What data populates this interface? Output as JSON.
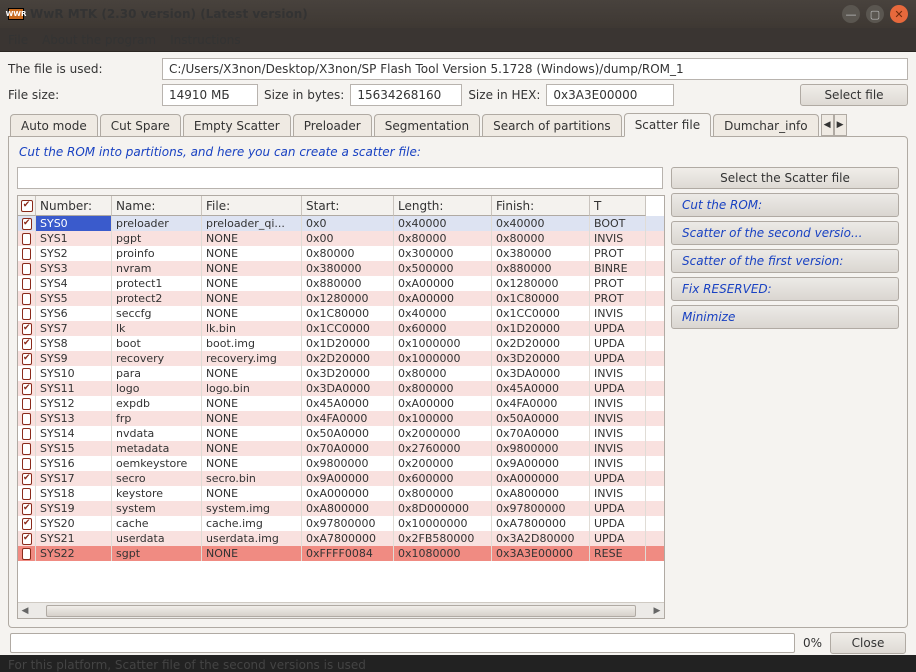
{
  "window": {
    "icon_text": "WWR",
    "title": "WwR MTK (2.30 version) (Latest version)"
  },
  "menu": {
    "items": [
      "File",
      "About the program",
      "Instructions"
    ]
  },
  "fileRow": {
    "label": "The file is used:",
    "value": "C:/Users/X3non/Desktop/X3non/SP Flash Tool Version 5.1728 (Windows)/dump/ROM_1"
  },
  "sizeRow": {
    "label": "File size:",
    "size_value": "14910 МБ",
    "bytes_label": "Size in bytes:",
    "bytes_value": "15634268160",
    "hex_label": "Size in HEX:",
    "hex_value": "0x3A3E00000",
    "select_btn": "Select file"
  },
  "tabs": {
    "items": [
      "Auto mode",
      "Cut Spare",
      "Empty Scatter",
      "Preloader",
      "Segmentation",
      "Search of partitions",
      "Scatter file",
      "Dumchar_info"
    ],
    "active": 6
  },
  "hint": "Cut the ROM into partitions, and here you can create a scatter file:",
  "side": {
    "main": "Select the Scatter file",
    "items": [
      "Cut the ROM:",
      "Scatter of the second versio...",
      "Scatter of the first version:",
      "Fix RESERVED:",
      "Minimize"
    ]
  },
  "table": {
    "headers": [
      "",
      "Number:",
      "Name:",
      "File:",
      "Start:",
      "Length:",
      "Finish:",
      "T"
    ],
    "rows": [
      {
        "chk": true,
        "sel": true,
        "alt": false,
        "n": "SYS0",
        "name": "preloader",
        "file": "preloader_qi...",
        "start": "0x0",
        "len": "0x40000",
        "fin": "0x40000",
        "t": "BOOT"
      },
      {
        "chk": false,
        "sel": false,
        "alt": true,
        "n": "SYS1",
        "name": "pgpt",
        "file": "NONE",
        "start": "0x00",
        "len": "0x80000",
        "fin": "0x80000",
        "t": "INVIS"
      },
      {
        "chk": false,
        "sel": false,
        "alt": false,
        "n": "SYS2",
        "name": "proinfo",
        "file": "NONE",
        "start": "0x80000",
        "len": "0x300000",
        "fin": "0x380000",
        "t": "PROT"
      },
      {
        "chk": false,
        "sel": false,
        "alt": true,
        "n": "SYS3",
        "name": "nvram",
        "file": "NONE",
        "start": "0x380000",
        "len": "0x500000",
        "fin": "0x880000",
        "t": "BINRE"
      },
      {
        "chk": false,
        "sel": false,
        "alt": false,
        "n": "SYS4",
        "name": "protect1",
        "file": "NONE",
        "start": "0x880000",
        "len": "0xA00000",
        "fin": "0x1280000",
        "t": "PROT"
      },
      {
        "chk": false,
        "sel": false,
        "alt": true,
        "n": "SYS5",
        "name": "protect2",
        "file": "NONE",
        "start": "0x1280000",
        "len": "0xA00000",
        "fin": "0x1C80000",
        "t": "PROT"
      },
      {
        "chk": false,
        "sel": false,
        "alt": false,
        "n": "SYS6",
        "name": "seccfg",
        "file": "NONE",
        "start": "0x1C80000",
        "len": "0x40000",
        "fin": "0x1CC0000",
        "t": "INVIS"
      },
      {
        "chk": true,
        "sel": false,
        "alt": true,
        "n": "SYS7",
        "name": "lk",
        "file": "lk.bin",
        "start": "0x1CC0000",
        "len": "0x60000",
        "fin": "0x1D20000",
        "t": "UPDA"
      },
      {
        "chk": true,
        "sel": false,
        "alt": false,
        "n": "SYS8",
        "name": "boot",
        "file": "boot.img",
        "start": "0x1D20000",
        "len": "0x1000000",
        "fin": "0x2D20000",
        "t": "UPDA"
      },
      {
        "chk": true,
        "sel": false,
        "alt": true,
        "n": "SYS9",
        "name": "recovery",
        "file": "recovery.img",
        "start": "0x2D20000",
        "len": "0x1000000",
        "fin": "0x3D20000",
        "t": "UPDA"
      },
      {
        "chk": false,
        "sel": false,
        "alt": false,
        "n": "SYS10",
        "name": "para",
        "file": "NONE",
        "start": "0x3D20000",
        "len": "0x80000",
        "fin": "0x3DA0000",
        "t": "INVIS"
      },
      {
        "chk": true,
        "sel": false,
        "alt": true,
        "n": "SYS11",
        "name": "logo",
        "file": "logo.bin",
        "start": "0x3DA0000",
        "len": "0x800000",
        "fin": "0x45A0000",
        "t": "UPDA"
      },
      {
        "chk": false,
        "sel": false,
        "alt": false,
        "n": "SYS12",
        "name": "expdb",
        "file": "NONE",
        "start": "0x45A0000",
        "len": "0xA00000",
        "fin": "0x4FA0000",
        "t": "INVIS"
      },
      {
        "chk": false,
        "sel": false,
        "alt": true,
        "n": "SYS13",
        "name": "frp",
        "file": "NONE",
        "start": "0x4FA0000",
        "len": "0x100000",
        "fin": "0x50A0000",
        "t": "INVIS"
      },
      {
        "chk": false,
        "sel": false,
        "alt": false,
        "n": "SYS14",
        "name": "nvdata",
        "file": "NONE",
        "start": "0x50A0000",
        "len": "0x2000000",
        "fin": "0x70A0000",
        "t": "INVIS"
      },
      {
        "chk": false,
        "sel": false,
        "alt": true,
        "n": "SYS15",
        "name": "metadata",
        "file": "NONE",
        "start": "0x70A0000",
        "len": "0x2760000",
        "fin": "0x9800000",
        "t": "INVIS"
      },
      {
        "chk": false,
        "sel": false,
        "alt": false,
        "n": "SYS16",
        "name": "oemkeystore",
        "file": "NONE",
        "start": "0x9800000",
        "len": "0x200000",
        "fin": "0x9A00000",
        "t": "INVIS"
      },
      {
        "chk": true,
        "sel": false,
        "alt": true,
        "n": "SYS17",
        "name": "secro",
        "file": "secro.bin",
        "start": "0x9A00000",
        "len": "0x600000",
        "fin": "0xA000000",
        "t": "UPDA"
      },
      {
        "chk": false,
        "sel": false,
        "alt": false,
        "n": "SYS18",
        "name": "keystore",
        "file": "NONE",
        "start": "0xA000000",
        "len": "0x800000",
        "fin": "0xA800000",
        "t": "INVIS"
      },
      {
        "chk": true,
        "sel": false,
        "alt": true,
        "n": "SYS19",
        "name": "system",
        "file": "system.img",
        "start": "0xA800000",
        "len": "0x8D000000",
        "fin": "0x97800000",
        "t": "UPDA"
      },
      {
        "chk": true,
        "sel": false,
        "alt": false,
        "n": "SYS20",
        "name": "cache",
        "file": "cache.img",
        "start": "0x97800000",
        "len": "0x10000000",
        "fin": "0xA7800000",
        "t": "UPDA"
      },
      {
        "chk": true,
        "sel": false,
        "alt": true,
        "n": "SYS21",
        "name": "userdata",
        "file": "userdata.img",
        "start": "0xA7800000",
        "len": "0x2FB580000",
        "fin": "0x3A2D80000",
        "t": "UPDA"
      },
      {
        "chk": false,
        "sel": false,
        "alt": false,
        "red": true,
        "n": "SYS22",
        "name": "sgpt",
        "file": "NONE",
        "start": "0xFFFF0084",
        "len": "0x1080000",
        "fin": "0x3A3E00000",
        "t": "RESE"
      }
    ]
  },
  "footer": {
    "percent": "0%",
    "close": "Close"
  },
  "status": "For this platform, Scatter file of the second versions is used"
}
